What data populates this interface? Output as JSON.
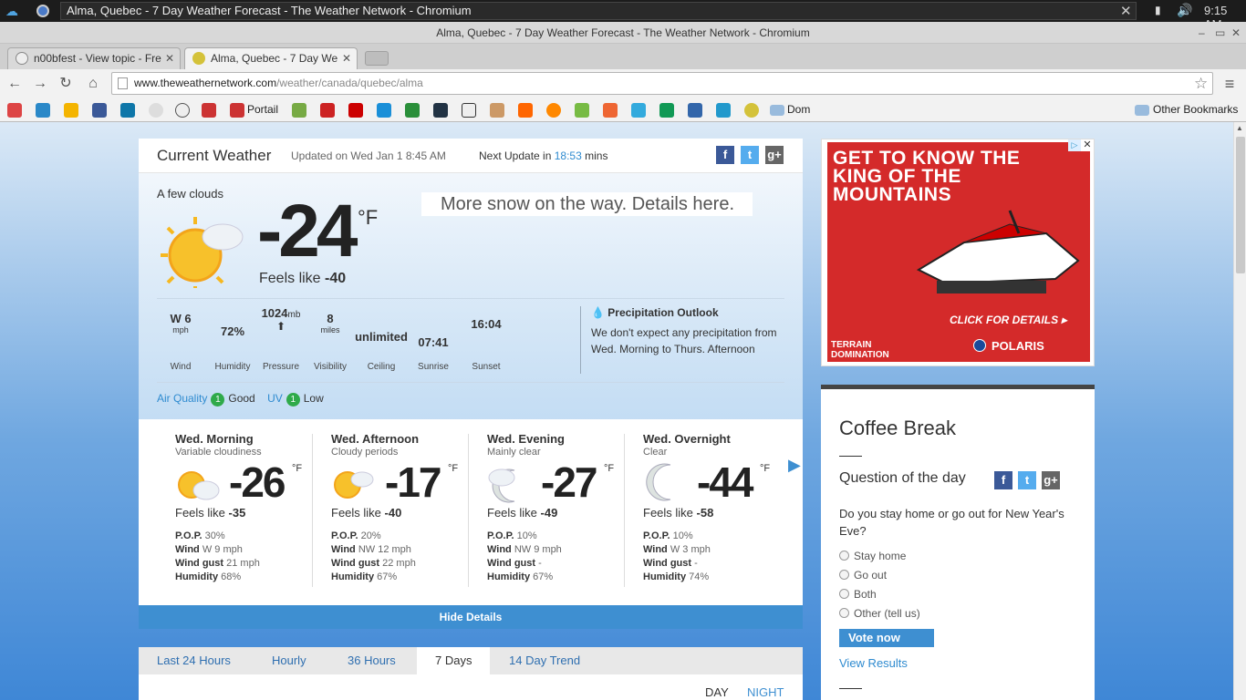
{
  "system": {
    "window_title": "Alma, Quebec - 7 Day Weather Forecast - The Weather Network - Chromium",
    "time": "9:15 AM"
  },
  "window": {
    "title": "Alma, Quebec - 7 Day Weather Forecast - The Weather Network - Chromium"
  },
  "tabs": [
    {
      "label": "n00bfest - View topic - Fre"
    },
    {
      "label": "Alma, Quebec - 7 Day We"
    }
  ],
  "omnibox": {
    "host": "www.theweathernetwork.com",
    "path": "/weather/canada/quebec/alma"
  },
  "bookmarks": {
    "portail": "Portail",
    "dom": "Dom",
    "other": "Other Bookmarks"
  },
  "current": {
    "header": "Current Weather",
    "updated": "Updated on Wed Jan 1 8:45 AM",
    "next_update_label": "Next Update in",
    "next_update_value": "18:53",
    "next_update_unit": "mins",
    "condition": "A few clouds",
    "temp": "-24",
    "unit": "°F",
    "feels_label": "Feels like",
    "feels_value": "-40",
    "news": "More snow on the way. Details here.",
    "details": [
      {
        "value": "W 6",
        "sub": "mph",
        "label": "Wind"
      },
      {
        "value": "72%",
        "sub": "",
        "label": "Humidity"
      },
      {
        "value": "1024",
        "sub": "mb",
        "label": "Pressure"
      },
      {
        "value": "8",
        "sub": "miles",
        "label": "Visibility"
      },
      {
        "value": "unlimited",
        "sub": "",
        "label": "Ceiling"
      },
      {
        "value": "07:41",
        "sub": "",
        "label": "Sunrise"
      },
      {
        "value": "16:04",
        "sub": "",
        "label": "Sunset"
      }
    ],
    "precip_title": "Precipitation Outlook",
    "precip_text": "We don't expect any precipitation from Wed. Morning to Thurs. Afternoon",
    "air_quality_label": "Air Quality",
    "air_quality_index": "1",
    "air_quality_level": "Good",
    "uv_label": "UV",
    "uv_index": "1",
    "uv_level": "Low"
  },
  "forecast": [
    {
      "name": "Wed. Morning",
      "cond": "Variable cloudiness",
      "temp": "-26",
      "unit": "°F",
      "feels_label": "Feels like",
      "feels": "-35",
      "pop": "30%",
      "wind": "W 9 mph",
      "gust": "21 mph",
      "humidity": "68%"
    },
    {
      "name": "Wed. Afternoon",
      "cond": "Cloudy periods",
      "temp": "-17",
      "unit": "°F",
      "feels_label": "Feels like",
      "feels": "-40",
      "pop": "20%",
      "wind": "NW 12 mph",
      "gust": "22 mph",
      "humidity": "67%"
    },
    {
      "name": "Wed. Evening",
      "cond": "Mainly clear",
      "temp": "-27",
      "unit": "°F",
      "feels_label": "Feels like",
      "feels": "-49",
      "pop": "10%",
      "wind": "NW 9 mph",
      "gust": "-",
      "humidity": "67%"
    },
    {
      "name": "Wed. Overnight",
      "cond": "Clear",
      "temp": "-44",
      "unit": "°F",
      "feels_label": "Feels like",
      "feels": "-58",
      "pop": "10%",
      "wind": "W 3 mph",
      "gust": "-",
      "humidity": "74%"
    }
  ],
  "forecast_labels": {
    "pop": "P.O.P.",
    "wind": "Wind",
    "gust": "Wind gust",
    "humidity": "Humidity"
  },
  "hide_details": "Hide Details",
  "period_tabs": [
    "Last 24 Hours",
    "Hourly",
    "36 Hours",
    "7 Days",
    "14 Day Trend"
  ],
  "daynight": {
    "day": "DAY",
    "night": "NIGHT"
  },
  "ad": {
    "headline": "GET TO KNOW THE KING OF THE MOUNTAINS",
    "cta": "CLICK FOR DETAILS ▸",
    "brand1": "TERRAIN DOMINATION",
    "brand2": "POLARIS"
  },
  "coffee": {
    "title": "Coffee Break",
    "question_title": "Question of the day",
    "question": "Do you stay home or go out for New Year's Eve?",
    "options": [
      "Stay home",
      "Go out",
      "Both",
      "Other (tell us)"
    ],
    "vote": "Vote now",
    "view_results": "View Results"
  },
  "colors": {
    "accent": "#3e8fd1",
    "ad_red": "#d42a2a",
    "good": "#2faa4a"
  }
}
